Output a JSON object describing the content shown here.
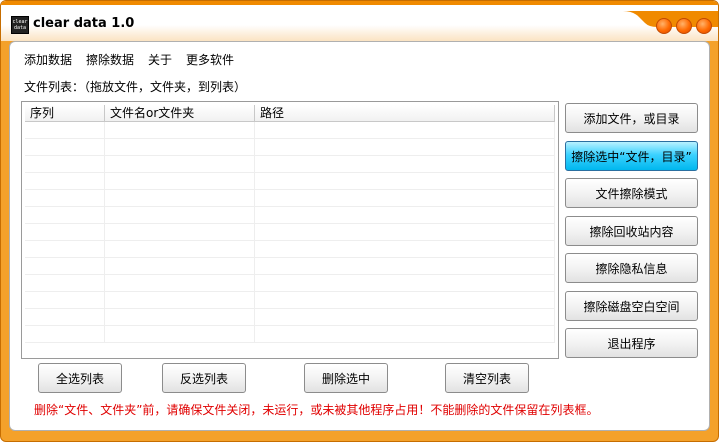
{
  "window": {
    "title": "clear data 1.0",
    "icon_text": [
      "clear",
      "data"
    ]
  },
  "menu": [
    {
      "label": "添加数据"
    },
    {
      "label": "擦除数据"
    },
    {
      "label": "关于"
    },
    {
      "label": "更多软件"
    }
  ],
  "file_list_label": "文件列表：（拖放文件，文件夹，到列表）",
  "list": {
    "columns": [
      {
        "label": "序列"
      },
      {
        "label": "文件名or文件夹"
      },
      {
        "label": "路径"
      }
    ],
    "rows": []
  },
  "side_buttons": [
    {
      "label": "添加文件，或目录"
    },
    {
      "label": "擦除选中“文件，目录”"
    },
    {
      "label": "文件擦除模式"
    },
    {
      "label": "擦除回收站内容"
    },
    {
      "label": "擦除隐私信息"
    },
    {
      "label": "擦除磁盘空白空间"
    },
    {
      "label": "退出程序"
    }
  ],
  "bottom_buttons": [
    {
      "label": "全选列表"
    },
    {
      "label": "反选列表"
    },
    {
      "label": "删除选中"
    },
    {
      "label": "清空列表"
    }
  ],
  "warning_text": "删除“文件、文件夹”前，请确保文件关闭，未运行，或未被其他程序占用！不能删除的文件保留在列表框。",
  "colors": {
    "accent": "#f4a12a",
    "active_button": "#00b7ee",
    "warning": "#e00000"
  }
}
